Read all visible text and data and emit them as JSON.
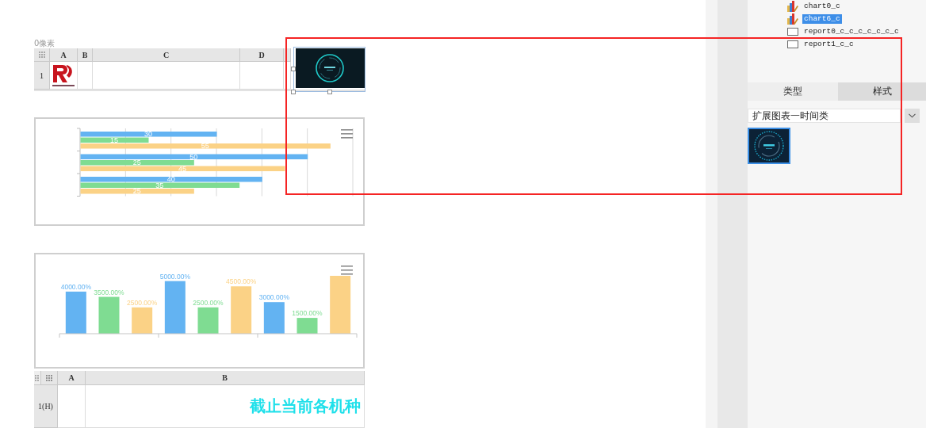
{
  "ruler": {
    "label": "0像素"
  },
  "top_grid": {
    "columns": [
      "A",
      "B",
      "C",
      "D"
    ],
    "rows": [
      {
        "header": "1"
      }
    ]
  },
  "chart_preview": {
    "selected": true
  },
  "bar_chart": {
    "chart_data": {
      "type": "bar",
      "orientation": "horizontal",
      "data_labels": true,
      "series": [
        {
          "color": "#63b3f2",
          "values": [
            30,
            50,
            40
          ]
        },
        {
          "color": "#7fdc92",
          "values": [
            15,
            25,
            35
          ]
        },
        {
          "color": "#fbd286",
          "values": [
            55,
            45,
            25
          ]
        }
      ]
    }
  },
  "column_chart": {
    "chart_data": {
      "type": "bar",
      "orientation": "vertical",
      "series": [
        {
          "color": "#63b3f2",
          "values": [
            4000,
            5000,
            3000
          ],
          "value_labels": [
            "4000.00%",
            "5000.00%",
            "3000.00%"
          ]
        },
        {
          "color": "#7fdc92",
          "values": [
            3500,
            2500,
            1500
          ],
          "value_labels": [
            "3500.00%",
            "2500.00%",
            "1500.00%"
          ]
        },
        {
          "color": "#fbd286",
          "values": [
            2500,
            4500,
            5500
          ],
          "value_labels": [
            "2500.00%",
            "4500.00%",
            null
          ]
        }
      ]
    }
  },
  "bottom_grid": {
    "columns": [
      "A",
      "B"
    ],
    "rows": [
      {
        "header": "1(H)",
        "title": "截止当前各机种"
      }
    ]
  },
  "component_tree": {
    "items": [
      {
        "label": "chart0_c",
        "kind": "chart",
        "selected": false
      },
      {
        "label": "chart6_c",
        "kind": "chart",
        "selected": true
      },
      {
        "label": "report0_c_c_c_c_c_c_c",
        "kind": "report",
        "selected": false
      },
      {
        "label": "report1_c_c",
        "kind": "report",
        "selected": false
      }
    ]
  },
  "tabs": [
    {
      "label": "类型",
      "selected": true
    },
    {
      "label": "样式",
      "selected": false
    }
  ],
  "chart_type_select": {
    "value": "扩展图表一时间类"
  },
  "style_thumbnails": [
    {
      "selected": true
    }
  ]
}
